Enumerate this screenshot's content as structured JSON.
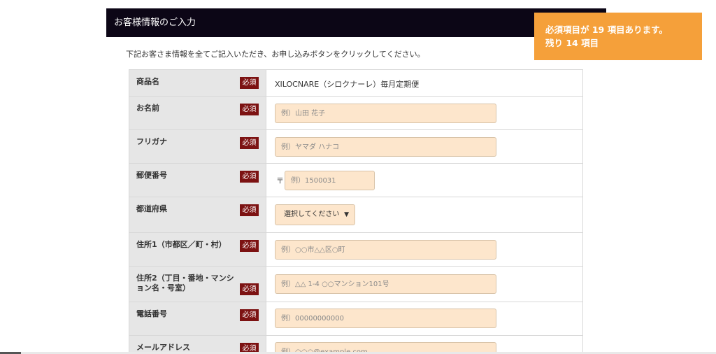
{
  "header": {
    "title": "お客様情報のご入力"
  },
  "notice": {
    "line1": "必須項目が 19 項目あります。",
    "line2": "残り 14 項目"
  },
  "intro": "下記お客さま情報を全てご記入いただき、お申し込みボタンをクリックしてください。",
  "required_label": "必須",
  "rows": [
    {
      "label": "商品名",
      "value": "XILOCNARE（シロクナーレ）毎月定期便"
    },
    {
      "label": "お名前",
      "placeholder": "例）山田 花子"
    },
    {
      "label": "フリガナ",
      "placeholder": "例）ヤマダ ハナコ"
    },
    {
      "label": "郵便番号",
      "prefix": "〒",
      "placeholder": "例）1500031"
    },
    {
      "label": "都道府県",
      "select_value": "選択してください"
    },
    {
      "label": "住所1（市都区／町・村）",
      "placeholder": "例）○○市△△区○町"
    },
    {
      "label": "住所2（丁目・番地・マンション名・号室）",
      "placeholder": "例）△△ 1-4 ○○マンション101号"
    },
    {
      "label": "電話番号",
      "placeholder": "例）00000000000"
    },
    {
      "label": "メールアドレス",
      "placeholder": "例）○○○@example.com"
    }
  ]
}
